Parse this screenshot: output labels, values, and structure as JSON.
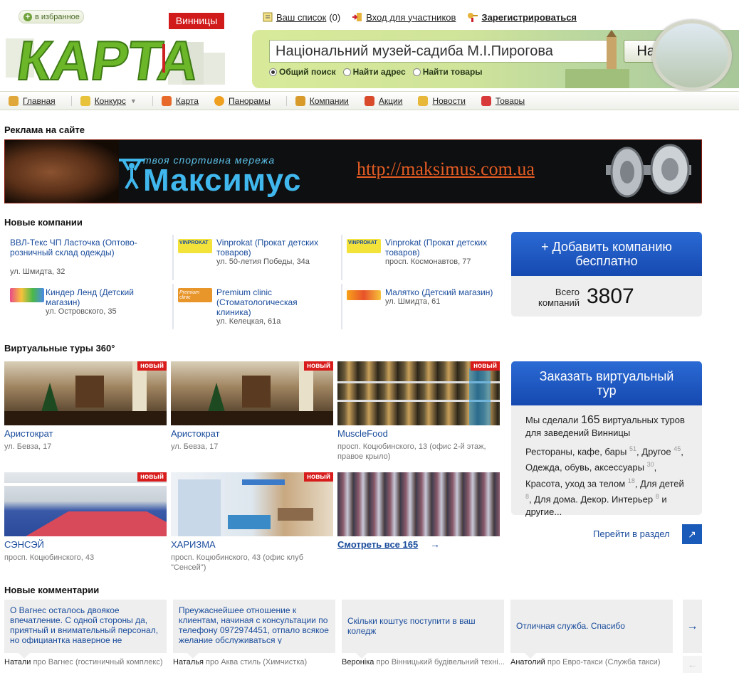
{
  "header": {
    "favorites_label": "в избранное",
    "logo_text": "КАРТА",
    "city": "Винницы",
    "links": [
      {
        "label": "Ваш список",
        "count": "(0)"
      },
      {
        "label": "Вход для участников"
      },
      {
        "label": "Зарегистрироваться"
      }
    ],
    "search": {
      "value": "Національний музей-садиба М.І.Пирогова",
      "button": "Найти",
      "options": [
        "Общий поиск",
        "Найти адрес",
        "Найти товары"
      ]
    }
  },
  "nav": [
    "Главная",
    "Конкурс",
    "Карта",
    "Панорамы",
    "Компании",
    "Акции",
    "Новости",
    "Товары"
  ],
  "ad": {
    "title": "Реклама на сайте",
    "tagline": "твоя спортивна мережа",
    "brand": "Максимус",
    "url": "http://maksimus.com.ua"
  },
  "new_companies": {
    "title": "Новые компании",
    "items": [
      {
        "name": "ВВЛ-Текс ЧП Ласточка (Оптово-розничный склад одежды)",
        "address": "ул. Шмидта,  32"
      },
      {
        "name": "Vinprokat (Прокат детских товаров)",
        "address": "ул. 50-летия Победы,  34а",
        "logo_text": "VINPROKAT"
      },
      {
        "name": "Vinprokat (Прокат детских товаров)",
        "address": "просп. Космонавтов,  77",
        "logo_text": "VINPROKAT"
      },
      {
        "name": "Киндер Ленд (Детский магазин)",
        "address": "ул. Островского,  35"
      },
      {
        "name": "Premium clinic (Стоматологическая клиника)",
        "address": "ул. Келецкая,  61а",
        "logo_text": "Premium clinic"
      },
      {
        "name": "Малятко (Детский магазин)",
        "address": "ул. Шмидта,  61"
      }
    ],
    "add_button": "+ Добавить компанию бесплатно",
    "total_label": "Всего компаний",
    "total": "3807"
  },
  "tours": {
    "title": "Виртуальные туры 360°",
    "badge": "новый",
    "items": [
      {
        "name": "Аристократ",
        "address": "ул. Бевза,  17",
        "new": true
      },
      {
        "name": "Аристократ",
        "address": "ул. Бевза,  17",
        "new": true
      },
      {
        "name": "MuscleFood",
        "address": "просп. Коцюбинского,  13 (офис 2-й этаж, правое крыло)",
        "new": true
      },
      {
        "name": "СЭНСЭЙ",
        "address": "просп. Коцюбинского,  43",
        "new": true
      },
      {
        "name": "ХАРИЗМА",
        "address": "просп. Коцюбинского,  43 (офис клуб \"Сенсей\")",
        "new": true
      }
    ],
    "see_all": "Смотреть все 165",
    "order_button": "Заказать виртуальный тур",
    "info_prefix": "Мы сделали",
    "info_count": "165",
    "info_suffix": "виртуальных туров для заведений Винницы",
    "categories": [
      {
        "name": "Рестораны, кафе, бары",
        "count": "51"
      },
      {
        "name": "Другое",
        "count": "45"
      },
      {
        "name": "Одежда, обувь, аксессуары",
        "count": "30"
      },
      {
        "name": "Красота, уход за телом",
        "count": "18"
      },
      {
        "name": "Для детей",
        "count": "8"
      },
      {
        "name": "Для дома. Декор. Интерьер",
        "count": "8"
      }
    ],
    "and_others": "и другие...",
    "go_section": "Перейти в раздел"
  },
  "comments": {
    "title": "Новые комментарии",
    "items": [
      {
        "text": "О Вагнес осталось двоякое впечатление. С одной стороны да, приятный и внимательный персонал, но официантка наверное не",
        "author": "Натали",
        "about": "про Вагнес (гостиничный комплекс)"
      },
      {
        "text": "Преужаснейшее отношение к клиентам, начиная с консультации по телефону 0972974451, отпало всякое желание обслуживаться у",
        "author": "Наталья",
        "about": "про Аква стиль (Химчистка)"
      },
      {
        "text": "Скільки коштує поступити в ваш коледж",
        "author": "Вероніка",
        "about": "про Вінницький будівельний техні..."
      },
      {
        "text": "Отличная служба. Спасибо",
        "author": "Анатолий",
        "about": "про Евро-такси (Служба такси)"
      }
    ]
  }
}
